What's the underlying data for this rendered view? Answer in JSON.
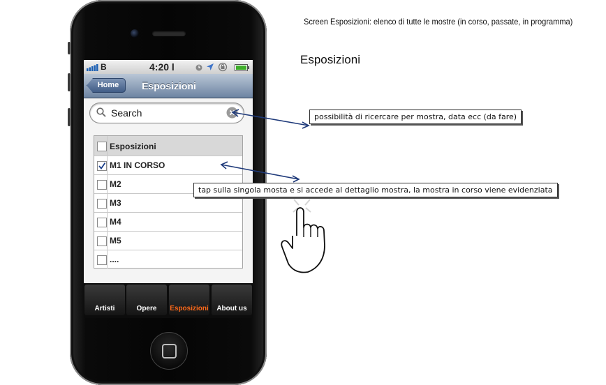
{
  "caption": "Screen Esposizioni: elenco di tutte le mostre (in corso, passate, in programma)",
  "heading": "Esposizioni",
  "status_bar": {
    "carrier": "B",
    "time": "4:20 l"
  },
  "nav": {
    "back_label": "Home",
    "title": "Esposizioni"
  },
  "search": {
    "placeholder": "Search"
  },
  "list": {
    "header": "Esposizioni",
    "rows": [
      {
        "label": "M1 IN CORSO",
        "checked": true
      },
      {
        "label": "M2",
        "checked": false
      },
      {
        "label": "M3",
        "checked": false
      },
      {
        "label": "M4",
        "checked": false
      },
      {
        "label": "M5",
        "checked": false
      },
      {
        "label": "....",
        "checked": false
      }
    ]
  },
  "tabs": [
    {
      "label": "Artisti",
      "active": false
    },
    {
      "label": "Opere",
      "active": false
    },
    {
      "label": "Esposizioni",
      "active": true
    },
    {
      "label": "About us",
      "active": false
    }
  ],
  "notes": {
    "search": "possibilità di ricercare per mostra, data ecc (da fare)",
    "tap": "tap sulla singola mosta e si accede al dettaglio mostra, la mostra in corso viene evidenziata"
  },
  "colors": {
    "active_tab": "#ff6a1a",
    "nav_bar": "#7a8fac",
    "arrow": "#1f3a7a"
  }
}
